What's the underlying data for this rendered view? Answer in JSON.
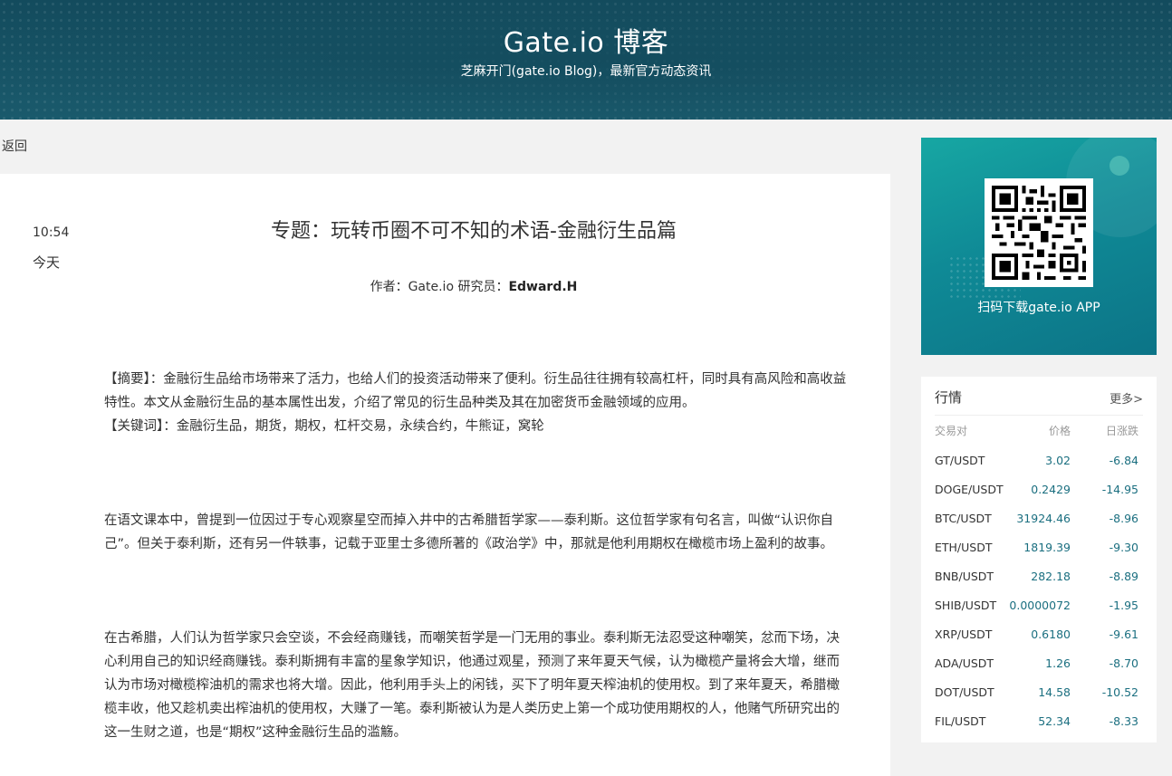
{
  "header": {
    "title": "Gate.io 博客",
    "subtitle": "芝麻开门(gate.io Blog)，最新官方动态资讯"
  },
  "nav": {
    "back_label": "返回"
  },
  "article": {
    "time": "10:54",
    "day": "今天",
    "title": "专题：玩转币圈不可不知的术语-金融衍生品篇",
    "author_prefix": "作者：Gate.io 研究员：",
    "author_name": "Edward.H",
    "abstract": "【摘要】：金融衍生品给市场带来了活力，也给人们的投资活动带来了便利。衍生品往往拥有较高杠杆，同时具有高风险和高收益特性。本文从金融衍生品的基本属性出发，介绍了常见的衍生品种类及其在加密货币金融领域的应用。",
    "keywords": "【关键词】：金融衍生品，期货，期权，杠杆交易，永续合约，牛熊证，窝轮",
    "p1": "在语文课本中，曾提到一位因过于专心观察星空而掉入井中的古希腊哲学家——泰利斯。这位哲学家有句名言，叫做“认识你自己”。但关于泰利斯，还有另一件轶事，记载于亚里士多德所著的《政治学》中，那就是他利用期权在橄榄市场上盈利的故事。",
    "p2": "在古希腊，人们认为哲学家只会空谈，不会经商赚钱，而嘲笑哲学是一门无用的事业。泰利斯无法忍受这种嘲笑，忿而下场，决心利用自己的知识经商赚钱。泰利斯拥有丰富的星象学知识，他通过观星，预测了来年夏天气候，认为橄榄产量将会大增，继而认为市场对橄榄榨油机的需求也将大增。因此，他利用手头上的闲钱，买下了明年夏天榨油机的使用权。到了来年夏天，希腊橄榄丰收，他又趁机卖出榨油机的使用权，大赚了一笔。泰利斯被认为是人类历史上第一个成功使用期权的人，他赌气所研究出的这一生财之道，也是“期权”这种金融衍生品的滥觞。"
  },
  "sidebar": {
    "qr_label": "扫码下载gate.io APP",
    "market": {
      "title": "行情",
      "more": "更多>",
      "headers": {
        "pair": "交易对",
        "price": "价格",
        "change": "日涨跌"
      },
      "rows": [
        {
          "pair": "GT/USDT",
          "price": "3.02",
          "change": "-6.84"
        },
        {
          "pair": "DOGE/USDT",
          "price": "0.2429",
          "change": "-14.95"
        },
        {
          "pair": "BTC/USDT",
          "price": "31924.46",
          "change": "-8.96"
        },
        {
          "pair": "ETH/USDT",
          "price": "1819.39",
          "change": "-9.30"
        },
        {
          "pair": "BNB/USDT",
          "price": "282.18",
          "change": "-8.89"
        },
        {
          "pair": "SHIB/USDT",
          "price": "0.0000072",
          "change": "-1.95"
        },
        {
          "pair": "XRP/USDT",
          "price": "0.6180",
          "change": "-9.61"
        },
        {
          "pair": "ADA/USDT",
          "price": "1.26",
          "change": "-8.70"
        },
        {
          "pair": "DOT/USDT",
          "price": "14.58",
          "change": "-10.52"
        },
        {
          "pair": "FIL/USDT",
          "price": "52.34",
          "change": "-8.33"
        }
      ]
    }
  },
  "colors": {
    "header_bg": "#134b5d",
    "qr_card_bg": "#0f8a96",
    "market_value": "#1b6f80"
  }
}
